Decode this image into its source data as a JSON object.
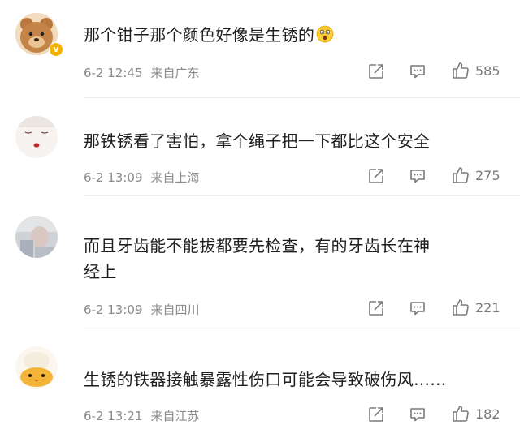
{
  "comments": [
    {
      "text": "那个钳子那个颜色好像是生锈的",
      "emoji": "astonished-face-icon",
      "time": "6-2 12:45",
      "location": "来自广东",
      "likes": "585",
      "verified_badge": "v"
    },
    {
      "text": "那铁锈看了害怕，拿个绳子把一下都比这个安全",
      "time": "6-2 13:09",
      "location": "来自上海",
      "likes": "275"
    },
    {
      "text": "而且牙齿能不能拔都要先检查，有的牙齿长在神经上",
      "time": "6-2 13:09",
      "location": "来自四川",
      "likes": "221"
    },
    {
      "text": "生锈的铁器接触暴露性伤口可能会导致破伤风……",
      "time": "6-2 13:21",
      "location": "来自江苏",
      "likes": "182"
    }
  ],
  "icons": {
    "share": "share-icon",
    "comment": "comment-icon",
    "like": "thumbs-up-icon"
  },
  "colors": {
    "meta_text": "#8b8b8b",
    "icon": "#7a7a7a",
    "badge": "#f5b300"
  }
}
